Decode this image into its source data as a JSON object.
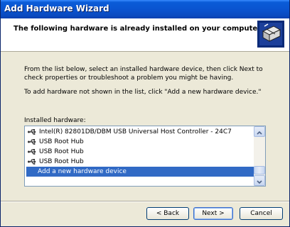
{
  "window": {
    "title": "Add Hardware Wizard"
  },
  "header": {
    "title": "The following hardware is already installed on your computer"
  },
  "body": {
    "paragraph1": "From the list below, select an installed hardware device, then click Next to check properties or troubleshoot a problem you might be having.",
    "paragraph2": "To add hardware not shown in the list, click \"Add a new hardware device.\""
  },
  "list": {
    "label": "Installed hardware:",
    "items": [
      {
        "label": "Intel(R) 82801DB/DBM USB Universal Host Controller - 24C7",
        "icon": "usb-icon"
      },
      {
        "label": "USB Root Hub",
        "icon": "usb-icon"
      },
      {
        "label": "USB Root Hub",
        "icon": "usb-icon"
      },
      {
        "label": "USB Root Hub",
        "icon": "usb-icon"
      },
      {
        "label": "Add a new hardware device",
        "icon": "",
        "selected": true
      }
    ]
  },
  "buttons": {
    "back": "< Back",
    "next": "Next >",
    "cancel": "Cancel"
  },
  "colors": {
    "titlebar": "#0a54d0",
    "selection": "#316ac5",
    "face": "#ece9d8"
  }
}
